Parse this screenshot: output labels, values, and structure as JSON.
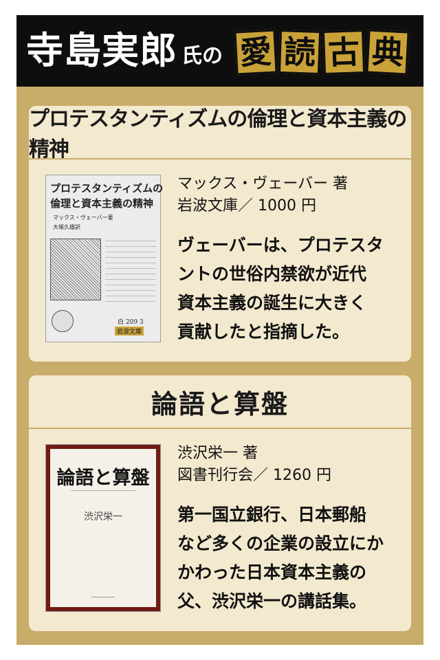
{
  "header": {
    "name": "寺島実郎",
    "suffix": "氏の",
    "kanji": [
      "愛",
      "読",
      "古",
      "典"
    ]
  },
  "books": [
    {
      "title": "プロテスタンティズムの倫理と資本主義の精神",
      "author": "マックス・ヴェーバー 著",
      "publisher": "岩波文庫／ 1000 円",
      "description": "ヴェーバーは、プロテスタントの世俗内禁欲が近代資本主義の誕生に大きく貢献したと指摘した。",
      "description_lines": [
        "ヴェーバーは、プロテスタ",
        "ントの世俗内禁欲が近代",
        "資本主義の誕生に大きく",
        "貢献したと指摘した。"
      ],
      "cover": {
        "title_line1": "プロテスタンティズムの",
        "title_line2": "倫理と資本主義の精神",
        "author": "マックス・ヴェーバー著",
        "translator": "大塚久雄訳",
        "number": "白 209 3",
        "label": "岩波文庫"
      }
    },
    {
      "title": "論語と算盤",
      "author": "渋沢栄一 著",
      "publisher": "図書刊行会／ 1260 円",
      "description": "第一国立銀行、日本郵船など多くの企業の設立にかかわった日本資本主義の父、渋沢栄一の講話集。",
      "description_lines": [
        "第一国立銀行、日本郵船",
        "など多くの企業の設立にか",
        "かわった日本資本主義の",
        "父、渋沢栄一の講話集。"
      ],
      "cover": {
        "title": "論語と算盤",
        "author": "渋沢栄一"
      }
    }
  ],
  "colors": {
    "frame": "#c8ac6a",
    "header": "#0e0e0e",
    "card": "#f3e9cf",
    "kanji_box": "#c9a238",
    "cover2_border": "#6e1c14"
  }
}
